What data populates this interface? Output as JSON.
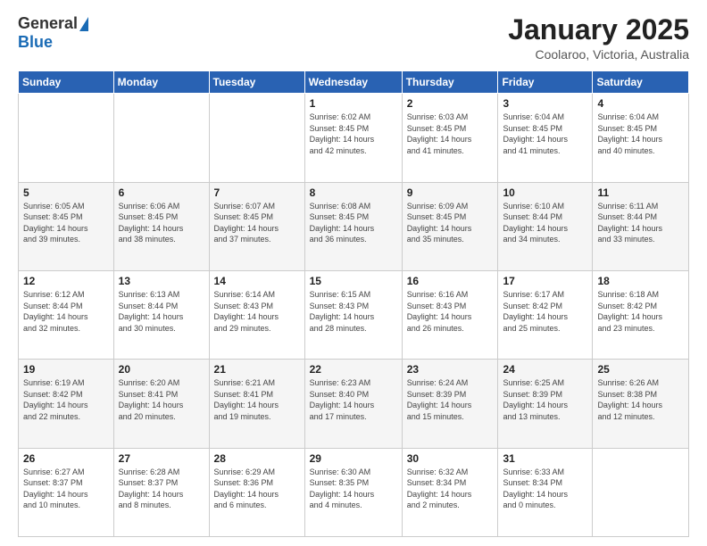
{
  "header": {
    "logo": {
      "general": "General",
      "blue": "Blue"
    },
    "title": "January 2025",
    "location": "Coolaroo, Victoria, Australia"
  },
  "weekdays": [
    "Sunday",
    "Monday",
    "Tuesday",
    "Wednesday",
    "Thursday",
    "Friday",
    "Saturday"
  ],
  "weeks": [
    [
      {
        "day": "",
        "info": ""
      },
      {
        "day": "",
        "info": ""
      },
      {
        "day": "",
        "info": ""
      },
      {
        "day": "1",
        "info": "Sunrise: 6:02 AM\nSunset: 8:45 PM\nDaylight: 14 hours\nand 42 minutes."
      },
      {
        "day": "2",
        "info": "Sunrise: 6:03 AM\nSunset: 8:45 PM\nDaylight: 14 hours\nand 41 minutes."
      },
      {
        "day": "3",
        "info": "Sunrise: 6:04 AM\nSunset: 8:45 PM\nDaylight: 14 hours\nand 41 minutes."
      },
      {
        "day": "4",
        "info": "Sunrise: 6:04 AM\nSunset: 8:45 PM\nDaylight: 14 hours\nand 40 minutes."
      }
    ],
    [
      {
        "day": "5",
        "info": "Sunrise: 6:05 AM\nSunset: 8:45 PM\nDaylight: 14 hours\nand 39 minutes."
      },
      {
        "day": "6",
        "info": "Sunrise: 6:06 AM\nSunset: 8:45 PM\nDaylight: 14 hours\nand 38 minutes."
      },
      {
        "day": "7",
        "info": "Sunrise: 6:07 AM\nSunset: 8:45 PM\nDaylight: 14 hours\nand 37 minutes."
      },
      {
        "day": "8",
        "info": "Sunrise: 6:08 AM\nSunset: 8:45 PM\nDaylight: 14 hours\nand 36 minutes."
      },
      {
        "day": "9",
        "info": "Sunrise: 6:09 AM\nSunset: 8:45 PM\nDaylight: 14 hours\nand 35 minutes."
      },
      {
        "day": "10",
        "info": "Sunrise: 6:10 AM\nSunset: 8:44 PM\nDaylight: 14 hours\nand 34 minutes."
      },
      {
        "day": "11",
        "info": "Sunrise: 6:11 AM\nSunset: 8:44 PM\nDaylight: 14 hours\nand 33 minutes."
      }
    ],
    [
      {
        "day": "12",
        "info": "Sunrise: 6:12 AM\nSunset: 8:44 PM\nDaylight: 14 hours\nand 32 minutes."
      },
      {
        "day": "13",
        "info": "Sunrise: 6:13 AM\nSunset: 8:44 PM\nDaylight: 14 hours\nand 30 minutes."
      },
      {
        "day": "14",
        "info": "Sunrise: 6:14 AM\nSunset: 8:43 PM\nDaylight: 14 hours\nand 29 minutes."
      },
      {
        "day": "15",
        "info": "Sunrise: 6:15 AM\nSunset: 8:43 PM\nDaylight: 14 hours\nand 28 minutes."
      },
      {
        "day": "16",
        "info": "Sunrise: 6:16 AM\nSunset: 8:43 PM\nDaylight: 14 hours\nand 26 minutes."
      },
      {
        "day": "17",
        "info": "Sunrise: 6:17 AM\nSunset: 8:42 PM\nDaylight: 14 hours\nand 25 minutes."
      },
      {
        "day": "18",
        "info": "Sunrise: 6:18 AM\nSunset: 8:42 PM\nDaylight: 14 hours\nand 23 minutes."
      }
    ],
    [
      {
        "day": "19",
        "info": "Sunrise: 6:19 AM\nSunset: 8:42 PM\nDaylight: 14 hours\nand 22 minutes."
      },
      {
        "day": "20",
        "info": "Sunrise: 6:20 AM\nSunset: 8:41 PM\nDaylight: 14 hours\nand 20 minutes."
      },
      {
        "day": "21",
        "info": "Sunrise: 6:21 AM\nSunset: 8:41 PM\nDaylight: 14 hours\nand 19 minutes."
      },
      {
        "day": "22",
        "info": "Sunrise: 6:23 AM\nSunset: 8:40 PM\nDaylight: 14 hours\nand 17 minutes."
      },
      {
        "day": "23",
        "info": "Sunrise: 6:24 AM\nSunset: 8:39 PM\nDaylight: 14 hours\nand 15 minutes."
      },
      {
        "day": "24",
        "info": "Sunrise: 6:25 AM\nSunset: 8:39 PM\nDaylight: 14 hours\nand 13 minutes."
      },
      {
        "day": "25",
        "info": "Sunrise: 6:26 AM\nSunset: 8:38 PM\nDaylight: 14 hours\nand 12 minutes."
      }
    ],
    [
      {
        "day": "26",
        "info": "Sunrise: 6:27 AM\nSunset: 8:37 PM\nDaylight: 14 hours\nand 10 minutes."
      },
      {
        "day": "27",
        "info": "Sunrise: 6:28 AM\nSunset: 8:37 PM\nDaylight: 14 hours\nand 8 minutes."
      },
      {
        "day": "28",
        "info": "Sunrise: 6:29 AM\nSunset: 8:36 PM\nDaylight: 14 hours\nand 6 minutes."
      },
      {
        "day": "29",
        "info": "Sunrise: 6:30 AM\nSunset: 8:35 PM\nDaylight: 14 hours\nand 4 minutes."
      },
      {
        "day": "30",
        "info": "Sunrise: 6:32 AM\nSunset: 8:34 PM\nDaylight: 14 hours\nand 2 minutes."
      },
      {
        "day": "31",
        "info": "Sunrise: 6:33 AM\nSunset: 8:34 PM\nDaylight: 14 hours\nand 0 minutes."
      },
      {
        "day": "",
        "info": ""
      }
    ]
  ]
}
